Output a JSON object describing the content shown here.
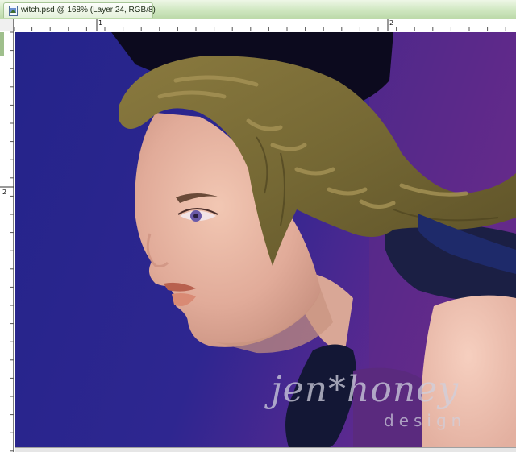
{
  "window": {
    "title": "witch.psd @ 168% (Layer 24, RGB/8)"
  },
  "rulers": {
    "horizontal_labels": [
      "1",
      "2"
    ],
    "vertical_labels": [
      "2"
    ]
  },
  "watermark": {
    "main": "jen*honey",
    "sub": "design"
  },
  "icons": {
    "document": "photoshop-document-icon"
  },
  "colors": {
    "title_bar": "#cfe7c0",
    "background_blue": "#2a2a8c",
    "background_purple": "#6a2a90",
    "hair": "#7d7037",
    "skin": "#e8b6a4",
    "watermark": "#c9c9d6"
  }
}
